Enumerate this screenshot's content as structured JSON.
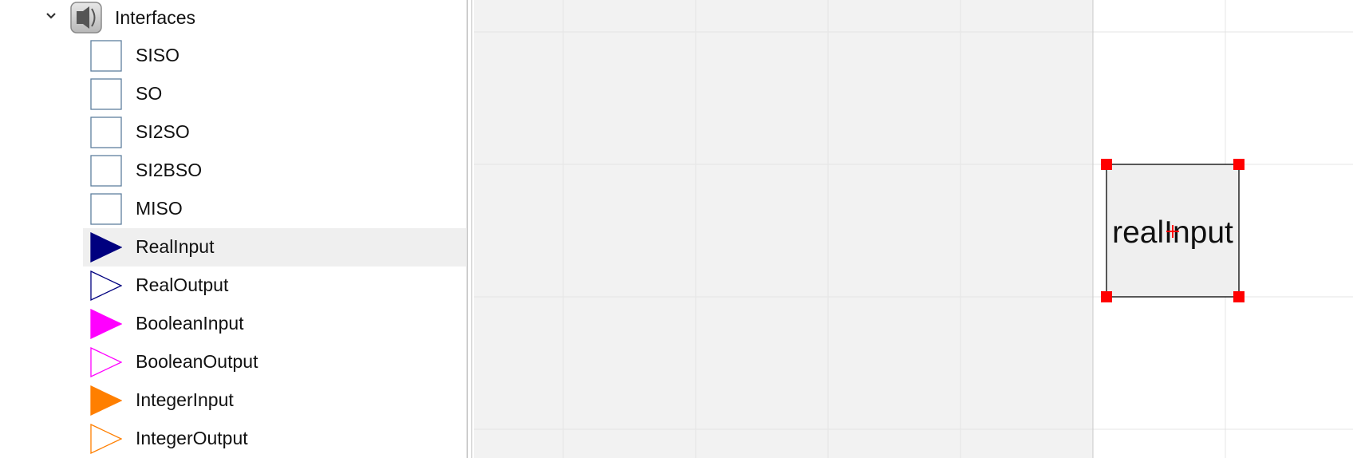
{
  "tree": {
    "package": {
      "label": "Interfaces",
      "icon": "package-icon",
      "expanded": true
    },
    "items": [
      {
        "label": "SISO",
        "icon": "siso-block-icon"
      },
      {
        "label": "SO",
        "icon": "so-block-icon"
      },
      {
        "label": "SI2SO",
        "icon": "si2so-block-icon"
      },
      {
        "label": "SI2BSO",
        "icon": "si2bso-block-icon"
      },
      {
        "label": "MISO",
        "icon": "miso-block-icon"
      },
      {
        "label": "RealInput",
        "icon": "real-input-icon",
        "selected": true
      },
      {
        "label": "RealOutput",
        "icon": "real-output-icon"
      },
      {
        "label": "BooleanInput",
        "icon": "boolean-input-icon"
      },
      {
        "label": "BooleanOutput",
        "icon": "boolean-output-icon"
      },
      {
        "label": "IntegerInput",
        "icon": "integer-input-icon"
      },
      {
        "label": "IntegerOutput",
        "icon": "integer-output-icon"
      }
    ]
  },
  "colors": {
    "real": "#00007f",
    "boolean": "#ff00ff",
    "integer": "#ff7f00",
    "block_border": "#5f7f9f",
    "selection_handle": "#ff0000",
    "canvas_shade": "#f2f2f2",
    "grid": "#e4e4e4"
  },
  "canvas": {
    "component": {
      "label": "realInput",
      "selected": true
    }
  }
}
